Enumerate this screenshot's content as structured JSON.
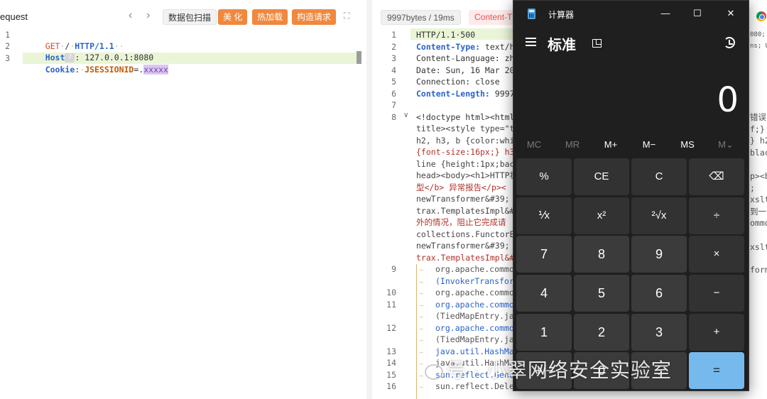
{
  "request_panel": {
    "title": "equest",
    "nav_back": "‹",
    "nav_forward": "›",
    "buttons": {
      "scan": "数据包扫描",
      "beautify": "美 化",
      "hot_reload": "热加载",
      "build_request": "构造请求"
    },
    "lines": [
      {
        "num": "1",
        "method": "GET",
        "path": "/",
        "version": "HTTP/1.1"
      },
      {
        "num": "2",
        "key": "Host",
        "value": "127.0.0.1:8080"
      },
      {
        "num": "3",
        "key": "Cookie",
        "cookie_name": "JSESSIONID",
        "cookie_value": "xxxxx"
      }
    ]
  },
  "response_panel": {
    "size_time": "9997bytes / 19ms",
    "content_tab": "Content-T",
    "side_text": [
      "080; Ht",
      "ns; URL",
      "错误",
      "f;}",
      "} h2",
      "black",
      "p><b>",
      ";",
      "xslte",
      "到一",
      "ommon",
      "xslte",
      "form"
    ],
    "lines": [
      {
        "num": "1",
        "text": "HTTP/1.1·500"
      },
      {
        "num": "2",
        "key": "Content-Type:",
        "value": "text/h"
      },
      {
        "num": "3",
        "text": "Content-Language: zh"
      },
      {
        "num": "4",
        "text": "Date: Sun, 16 Mar 20"
      },
      {
        "num": "5",
        "text": "Connection: close"
      },
      {
        "num": "6",
        "key": "Content-Length:",
        "value": "9997"
      },
      {
        "num": "7",
        "text": ""
      },
      {
        "num": "8",
        "text": "<!doctype html><html"
      },
      {
        "num": "",
        "text": "title><style type=\"t"
      },
      {
        "num": "",
        "text": "h2, h3, b {color:whi"
      },
      {
        "num": "",
        "text": "{font-size:16px;} h3"
      },
      {
        "num": "",
        "text": "line {height:1px;bac"
      },
      {
        "num": "",
        "text": "head><body><h1>HTTP状"
      },
      {
        "num": "",
        "text": "型</b> 异常报告</p><"
      },
      {
        "num": "",
        "text": "newTransformer&#39; "
      },
      {
        "num": "",
        "text": "trax.TemplatesImpl&#"
      },
      {
        "num": "",
        "text": "外的情况，阻止它完成请"
      },
      {
        "num": "",
        "text": "collections.FunctorE"
      },
      {
        "num": "",
        "text": "newTransformer&#39; "
      },
      {
        "num": "",
        "text": "trax.TemplatesImpl&#"
      },
      {
        "num": "9",
        "text": "org.apache.commo"
      },
      {
        "num": "",
        "text": "(InvokerTransfor"
      },
      {
        "num": "10",
        "text": "org.apache.commo"
      },
      {
        "num": "11",
        "text": "org.apache.commo"
      },
      {
        "num": "",
        "text": "(TiedMapEntry.ja"
      },
      {
        "num": "12",
        "text": "org.apache.commo"
      },
      {
        "num": "",
        "text": "(TiedMapEntry.ja"
      },
      {
        "num": "13",
        "text": "java.util.HashMa"
      },
      {
        "num": "14",
        "text": "java.util.HashMa"
      },
      {
        "num": "15",
        "text": "sun.reflect.Gene"
      },
      {
        "num": "16",
        "text": "sun.reflect.Dele"
      }
    ]
  },
  "calculator": {
    "window_title": "计算器",
    "minimize": "—",
    "maximize": "☐",
    "close": "✕",
    "mode": "标准",
    "display": "0",
    "memory": [
      "MC",
      "MR",
      "M+",
      "M−",
      "MS",
      "M⌄"
    ],
    "keys": [
      [
        "%",
        "CE",
        "C",
        "⌫"
      ],
      [
        "⅟x",
        "x²",
        "²√x",
        "÷"
      ],
      [
        "7",
        "8",
        "9",
        "×"
      ],
      [
        "4",
        "5",
        "6",
        "−"
      ],
      [
        "1",
        "2",
        "3",
        "+"
      ],
      [
        "+/−",
        "0",
        ".",
        "="
      ]
    ]
  },
  "watermark": "号 · 小翠网络安全实验室"
}
